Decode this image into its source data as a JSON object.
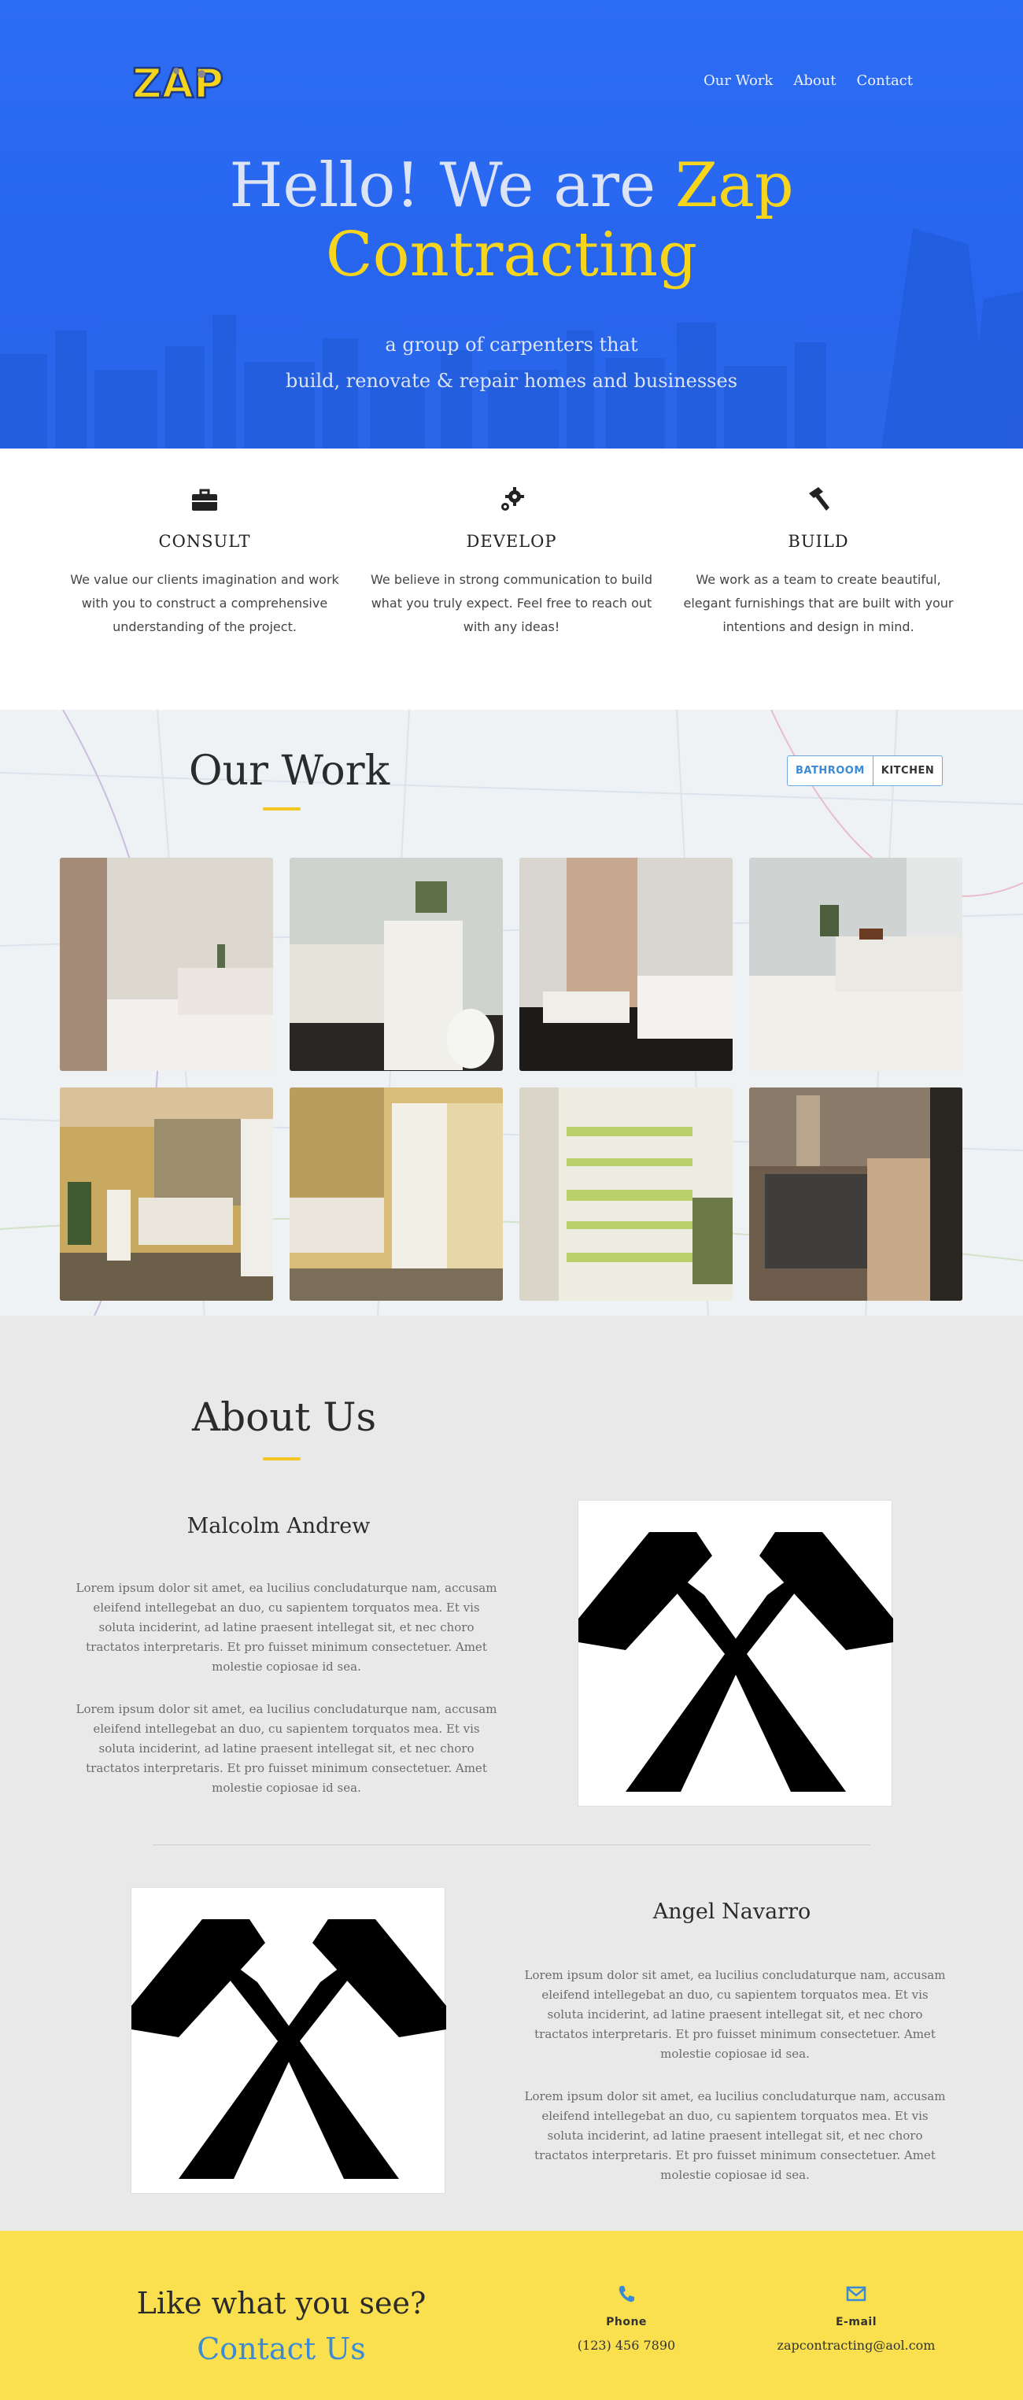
{
  "header": {
    "logo_text": "ZAP",
    "nav": [
      "Our Work",
      "About",
      "Contact"
    ]
  },
  "hero": {
    "title_prefix": "Hello! We are ",
    "title_accent_1": "Zap",
    "title_accent_2": "Contracting",
    "subtitle_line1": "a group of carpenters that",
    "subtitle_line2": "build, renovate & repair homes and businesses"
  },
  "features": [
    {
      "icon": "briefcase-icon",
      "title": "CONSULT",
      "text": "We value our clients imagination and work with you to construct a comprehensive understanding of the project."
    },
    {
      "icon": "gears-icon",
      "title": "DEVELOP",
      "text": "We believe in strong communication to build what you truly expect. Feel free to reach out with any ideas!"
    },
    {
      "icon": "hammer-icon",
      "title": "BUILD",
      "text": "We work as a team to create beautiful, elegant furnishings that are built with your intentions and design in mind."
    }
  ],
  "work": {
    "title": "Our Work",
    "filters": [
      "BATHROOM",
      "KITCHEN"
    ]
  },
  "about": {
    "title": "About Us",
    "people": [
      {
        "name": "Malcolm Andrew",
        "bio1": "Lorem ipsum dolor sit amet, ea lucilius concludaturque nam, accusam eleifend intellegebat an duo, cu sapientem torquatos mea. Et vis soluta inciderint, ad latine praesent intellegat sit, et nec choro tractatos interpretaris. Et pro fuisset minimum consectetuer. Amet molestie copiosae id sea.",
        "bio2": "Lorem ipsum dolor sit amet, ea lucilius concludaturque nam, accusam eleifend intellegebat an duo, cu sapientem torquatos mea. Et vis soluta inciderint, ad latine praesent intellegat sit, et nec choro tractatos interpretaris. Et pro fuisset minimum consectetuer. Amet molestie copiosae id sea."
      },
      {
        "name": "Angel Navarro",
        "bio1": "Lorem ipsum dolor sit amet, ea lucilius concludaturque nam, accusam eleifend intellegebat an duo, cu sapientem torquatos mea. Et vis soluta inciderint, ad latine praesent intellegat sit, et nec choro tractatos interpretaris. Et pro fuisset minimum consectetuer. Amet molestie copiosae id sea.",
        "bio2": "Lorem ipsum dolor sit amet, ea lucilius concludaturque nam, accusam eleifend intellegebat an duo, cu sapientem torquatos mea. Et vis soluta inciderint, ad latine praesent intellegat sit, et nec choro tractatos interpretaris. Et pro fuisset minimum consectetuer. Amet molestie copiosae id sea."
      }
    ]
  },
  "contact": {
    "question": "Like what you see?",
    "cta": "Contact Us",
    "phone_label": "Phone",
    "phone": "(123) 456 7890",
    "email_label": "E-mail",
    "email": "zapcontracting@aol.com"
  },
  "colors": {
    "brand_blue": "#2d6df3",
    "accent_yellow": "#f7d51d",
    "link_blue": "#3a8ad8",
    "contact_bg": "#fae04e"
  }
}
